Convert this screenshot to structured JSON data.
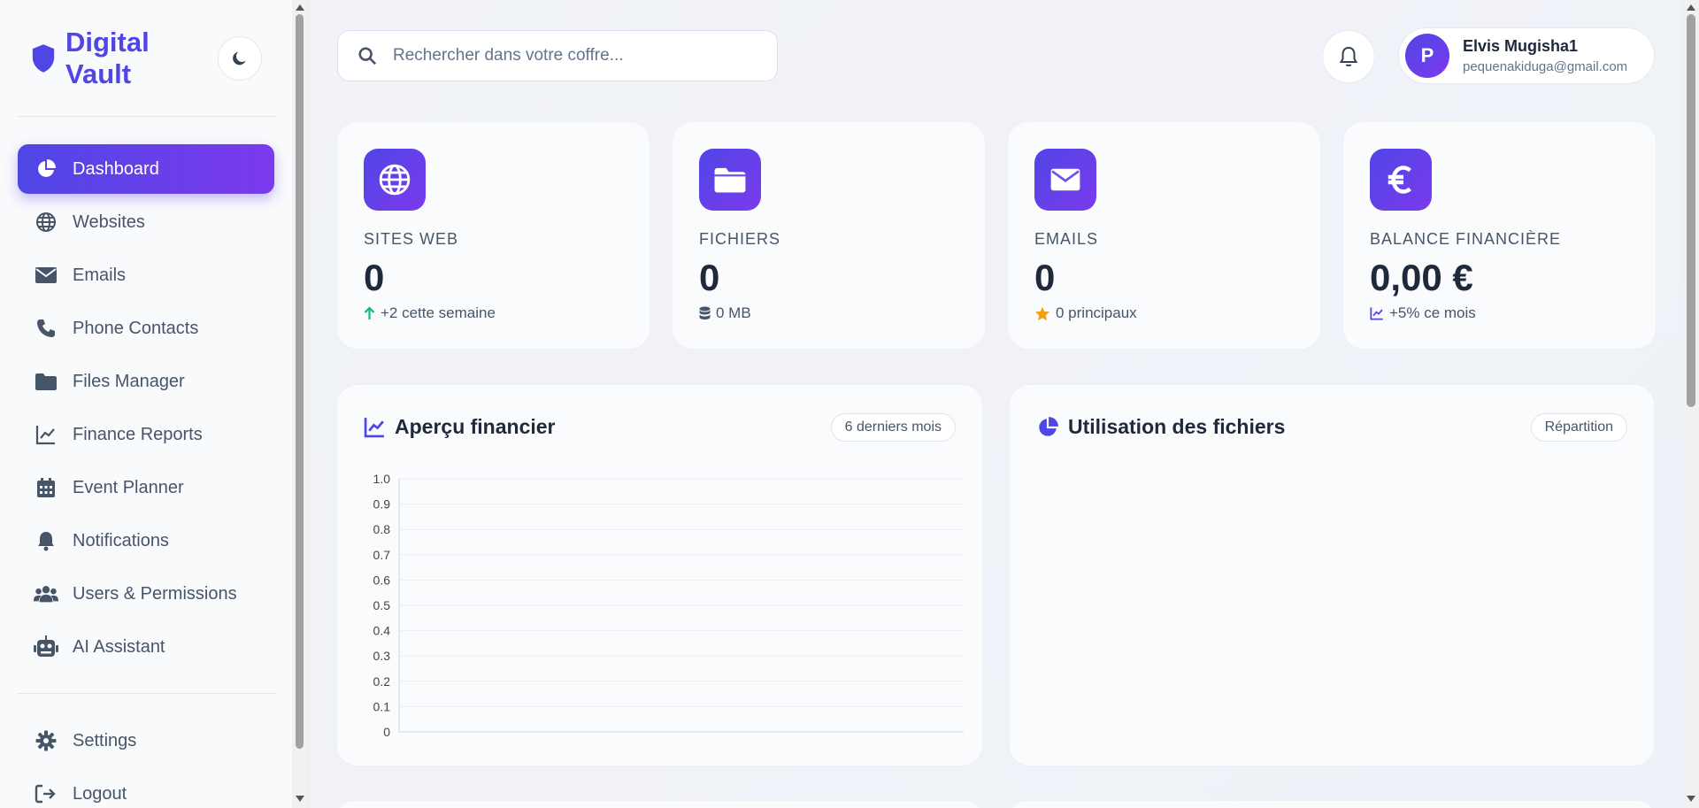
{
  "sidebar": {
    "brand": "Digital Vault",
    "nav": [
      {
        "label": "Dashboard",
        "icon": "chart-pie-icon",
        "active": true
      },
      {
        "label": "Websites",
        "icon": "globe-icon"
      },
      {
        "label": "Emails",
        "icon": "envelope-icon"
      },
      {
        "label": "Phone Contacts",
        "icon": "phone-icon"
      },
      {
        "label": "Files Manager",
        "icon": "folder-icon"
      },
      {
        "label": "Finance Reports",
        "icon": "line-chart-icon"
      },
      {
        "label": "Event Planner",
        "icon": "calendar-icon"
      },
      {
        "label": "Notifications",
        "icon": "bell-icon"
      },
      {
        "label": "Users & Permissions",
        "icon": "users-icon"
      },
      {
        "label": "AI Assistant",
        "icon": "robot-icon"
      }
    ],
    "bottom": [
      {
        "label": "Settings",
        "icon": "gear-icon"
      },
      {
        "label": "Logout",
        "icon": "logout-icon"
      }
    ]
  },
  "header": {
    "search_placeholder": "Rechercher dans votre coffre...",
    "user": {
      "initial": "P",
      "name": "Elvis Mugisha1",
      "email": "pequenakiduga@gmail.com"
    }
  },
  "stats": [
    {
      "label": "SITES WEB",
      "value": "0",
      "note": "+2 cette semaine",
      "icon": "globe-icon",
      "note_icon": "arrow-up-icon"
    },
    {
      "label": "FICHIERS",
      "value": "0",
      "note": "0 MB",
      "icon": "folder-icon",
      "note_icon": "database-icon"
    },
    {
      "label": "EMAILS",
      "value": "0",
      "note": "0 principaux",
      "icon": "envelope-icon",
      "note_icon": "star-icon"
    },
    {
      "label": "BALANCE FINANCIÈRE",
      "value": "0,00 €",
      "note": "+5% ce mois",
      "icon": "euro-icon",
      "note_icon": "line-chart-icon"
    }
  ],
  "panels": {
    "finance": {
      "title": "Aperçu financier",
      "pill": "6 derniers mois"
    },
    "files": {
      "title": "Utilisation des fichiers",
      "pill": "Répartition"
    }
  },
  "colors": {
    "accent": "#4f46e5",
    "accent2": "#7c3aed",
    "green": "#10b981",
    "star": "#f59e0b"
  },
  "chart_data": {
    "type": "line",
    "title": "Aperçu financier",
    "x": [],
    "series": [],
    "ylim": [
      0,
      1.0
    ],
    "yticks": [
      "0",
      "0.1",
      "0.2",
      "0.3",
      "0.4",
      "0.5",
      "0.6",
      "0.7",
      "0.8",
      "0.9",
      "1.0"
    ],
    "grid": true
  }
}
